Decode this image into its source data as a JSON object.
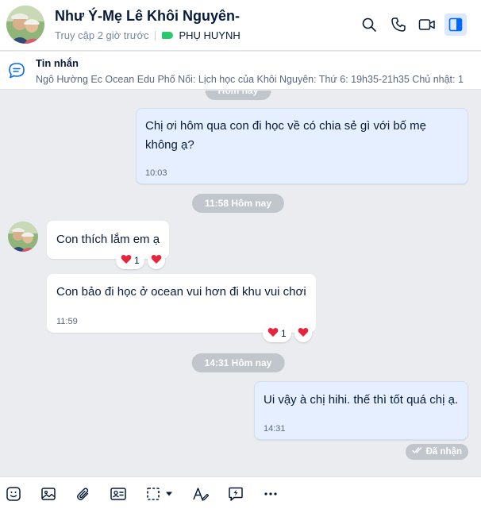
{
  "header": {
    "title": "Như Ý-Mẹ Lê Khôi Nguyên-",
    "last_seen": "Truy cập 2 giờ trước",
    "tag_label": "PHỤ HUYNH",
    "tag_color": "#2ac96d",
    "icons": [
      "search-icon",
      "phone-icon",
      "video-call-icon",
      "sidebar-toggle-icon"
    ]
  },
  "pinned": {
    "title": "Tin nhắn",
    "text": "Ngô Hường Ec Ocean Edu Phố Nối: Lịch học của Khôi Nguyên: Thứ 6: 19h35-21h35 Chủ nhật: 1..."
  },
  "chat": {
    "top_divider": "Hôm nay",
    "messages": [
      {
        "side": "mine",
        "text_line1": "Chị ơi hôm qua con đi học về có chia sẻ gì với bố mẹ",
        "text_line2": "không ạ?",
        "time": "10:03"
      },
      {
        "divider": "11:58 Hôm nay"
      },
      {
        "side": "theirs",
        "text": "Con thích lắm em ạ",
        "reaction_count": "1"
      },
      {
        "side": "theirs",
        "text": "Con bảo đi học ở ocean vui hơn đi khu vui chơi",
        "time": "11:59",
        "reaction_count": "1"
      },
      {
        "divider": "14:31 Hôm nay"
      },
      {
        "side": "mine",
        "text": "Ui vậy à chị hihi. thế thì tốt quá chị ạ.",
        "time": "14:31"
      }
    ],
    "status": "Đã nhận"
  },
  "toolbar": {
    "icons": [
      "sticker-icon",
      "image-icon",
      "attachment-icon",
      "contact-card-icon",
      "screenshot-icon",
      "text-format-icon",
      "quick-message-icon",
      "more-icon"
    ]
  },
  "colors": {
    "accent": "#0068ff",
    "my_bubble": "#e5efff",
    "chat_bg": "#ebecf0",
    "heart": "#e8243d"
  }
}
